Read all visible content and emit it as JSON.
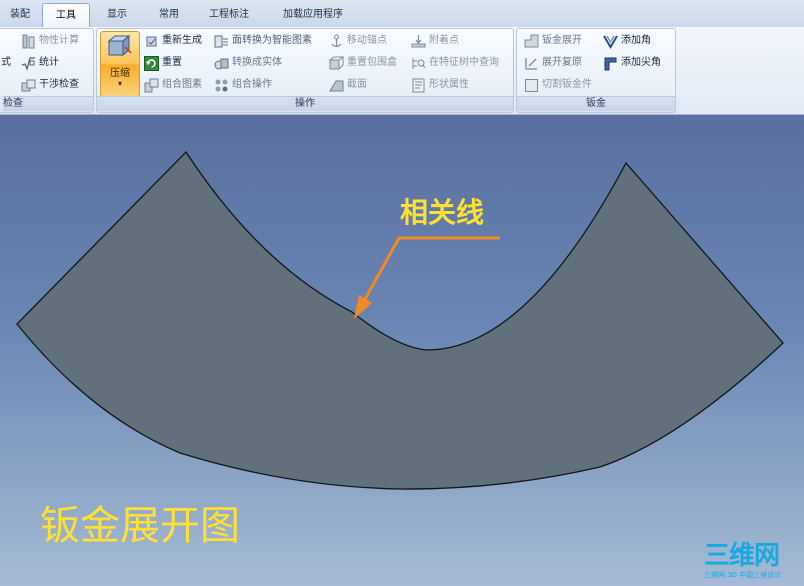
{
  "tabs": [
    {
      "label": "装配"
    },
    {
      "label": "工具"
    },
    {
      "label": "显示"
    },
    {
      "label": "常用"
    },
    {
      "label": "工程标注"
    },
    {
      "label": "加载应用程序"
    }
  ],
  "active_tab": "工具",
  "ribbon": {
    "inspect": {
      "label": "检查",
      "items": [
        "物性计算",
        "统计",
        "干涉检查"
      ],
      "left_partial": "式"
    },
    "ops": {
      "label": "操作",
      "big_button": "压缩",
      "col1": [
        "重新生成",
        "重置",
        "组合图素"
      ],
      "col2": [
        "面转换为智能图素",
        "转换成实体",
        "组合操作"
      ],
      "col3": [
        "移动锚点",
        "重置包围盒",
        "截面"
      ],
      "col4": [
        "附着点",
        "在特征树中查询",
        "形状属性"
      ]
    },
    "sheet": {
      "label": "钣金",
      "col1": [
        "钣金展开",
        "展开复原",
        "切割钣金件"
      ],
      "col2": [
        "添加角",
        "添加尖角"
      ]
    }
  },
  "viewport": {
    "annotation": "相关线",
    "title": "钣金展开图",
    "annotation_color": "#ffe033",
    "part_color": "#61717b"
  },
  "watermark": {
    "brand": "三维网",
    "tagline": "三维网 3D 中国三维设计"
  },
  "colors": {
    "active_button": "#fbc55a",
    "ribbon_bg": "#e9f0f8",
    "watermark": "#1aa8e0"
  }
}
